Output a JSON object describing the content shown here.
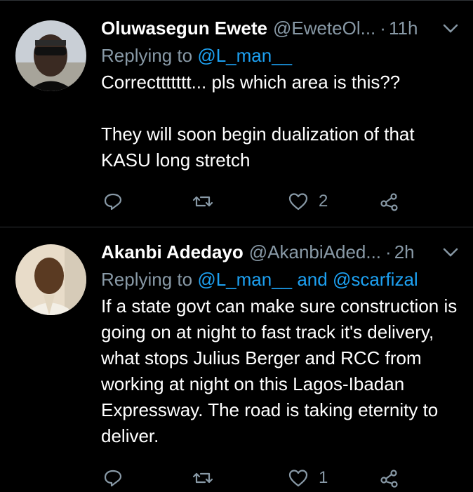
{
  "tweets": [
    {
      "name": "Oluwasegun Ewete",
      "handle": "@EweteOl...",
      "dot": "·",
      "time": "11h",
      "replying_prefix": "Replying to",
      "replying_to": "@L_man__",
      "body_paragraphs": [
        "Correcttttttt... pls which area is this??",
        "They will soon begin dualization of that KASU long stretch"
      ],
      "like_count": "2",
      "icons": [
        "reply-icon",
        "retweet-icon",
        "like-icon",
        "share-icon"
      ]
    },
    {
      "name": "Akanbi Adedayo",
      "handle": "@AkanbiAded...",
      "dot": "·",
      "time": "2h",
      "replying_prefix": "Replying to",
      "replying_to": "@L_man__ and @scarfizal",
      "body_paragraphs": [
        "If a state govt can make sure construction is going on at night to fast track it's delivery, what stops Julius Berger and RCC from working at night on this Lagos-Ibadan Expressway. The road is taking eternity to deliver."
      ],
      "like_count": "1",
      "icons": [
        "reply-icon",
        "retweet-icon",
        "like-icon",
        "share-icon"
      ]
    }
  ],
  "colors": {
    "background": "#000000",
    "text": "#ffffff",
    "secondary": "#8899a6",
    "link": "#1da1f2",
    "divider": "#2f3336"
  }
}
